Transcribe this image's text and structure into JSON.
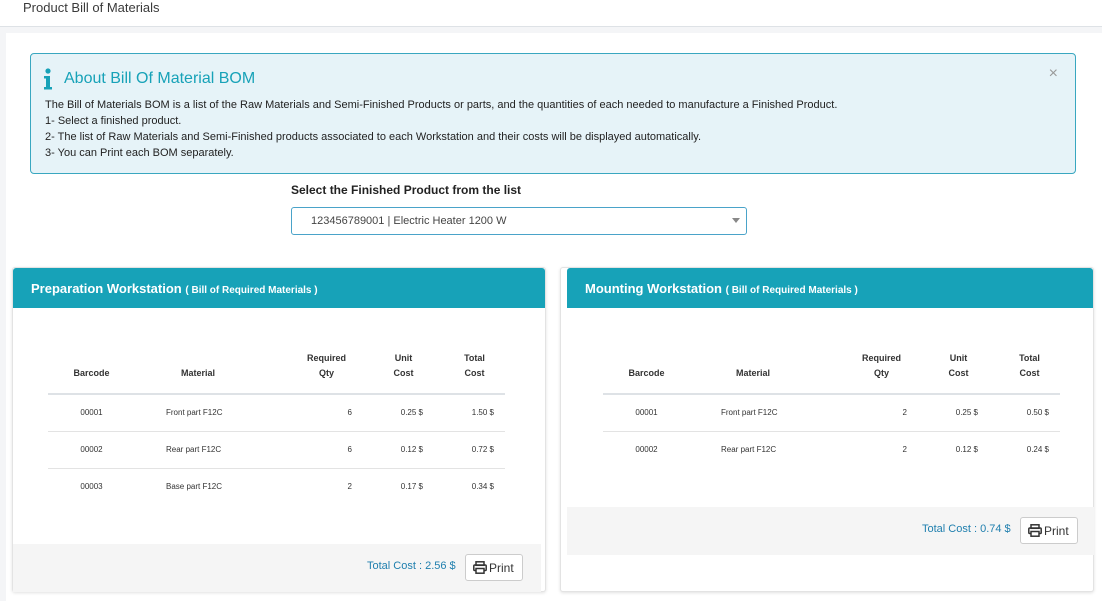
{
  "page": {
    "title": "Product Bill of Materials"
  },
  "alert": {
    "heading": "About Bill Of Material BOM",
    "lines": [
      "The Bill of Materials BOM is a list of the Raw Materials and Semi-Finished Products or parts, and the quantities of each needed to manufacture a Finished Product.",
      "1- Select a finished product.",
      "2- The list of Raw Materials and Semi-Finished products associated to each Workstation and their costs will be displayed automatically.",
      "3- You can Print each BOM separately."
    ],
    "close": "×"
  },
  "product_select": {
    "label": "Select the Finished Product from the list",
    "value": "123456789001 | Electric Heater 1200 W"
  },
  "columns": {
    "barcode": "Barcode",
    "material": "Material",
    "req_1": "Required",
    "req_2": "Qty",
    "unit_1": "Unit",
    "unit_2": "Cost",
    "total_1": "Total",
    "total_2": "Cost"
  },
  "workstations": [
    {
      "title": "Preparation Workstation",
      "subtitle": "( Bill of Required Materials )",
      "rows": [
        {
          "barcode": "00001",
          "material": "Front part F12C",
          "qty": "6",
          "unit_cost": "0.25 $",
          "total_cost": "1.50 $"
        },
        {
          "barcode": "00002",
          "material": "Rear part F12C",
          "qty": "6",
          "unit_cost": "0.12 $",
          "total_cost": "0.72 $"
        },
        {
          "barcode": "00003",
          "material": "Base part F12C",
          "qty": "2",
          "unit_cost": "0.17 $",
          "total_cost": "0.34 $"
        }
      ],
      "total": "Total Cost : 2.56 $",
      "print": "Print"
    },
    {
      "title": "Mounting Workstation",
      "subtitle": "( Bill of Required Materials )",
      "rows": [
        {
          "barcode": "00001",
          "material": "Front part F12C",
          "qty": "2",
          "unit_cost": "0.25 $",
          "total_cost": "0.50 $"
        },
        {
          "barcode": "00002",
          "material": "Rear part F12C",
          "qty": "2",
          "unit_cost": "0.12 $",
          "total_cost": "0.24 $"
        }
      ],
      "total": "Total Cost : 0.74 $",
      "print": "Print"
    }
  ],
  "colors": {
    "accent": "#17a2b8",
    "alert_bg": "#e6f3f8",
    "link": "#1f7fae"
  },
  "icons": {
    "info": "info-icon",
    "close": "close-icon",
    "print": "print-icon",
    "dropdown": "chevron-down-icon"
  }
}
